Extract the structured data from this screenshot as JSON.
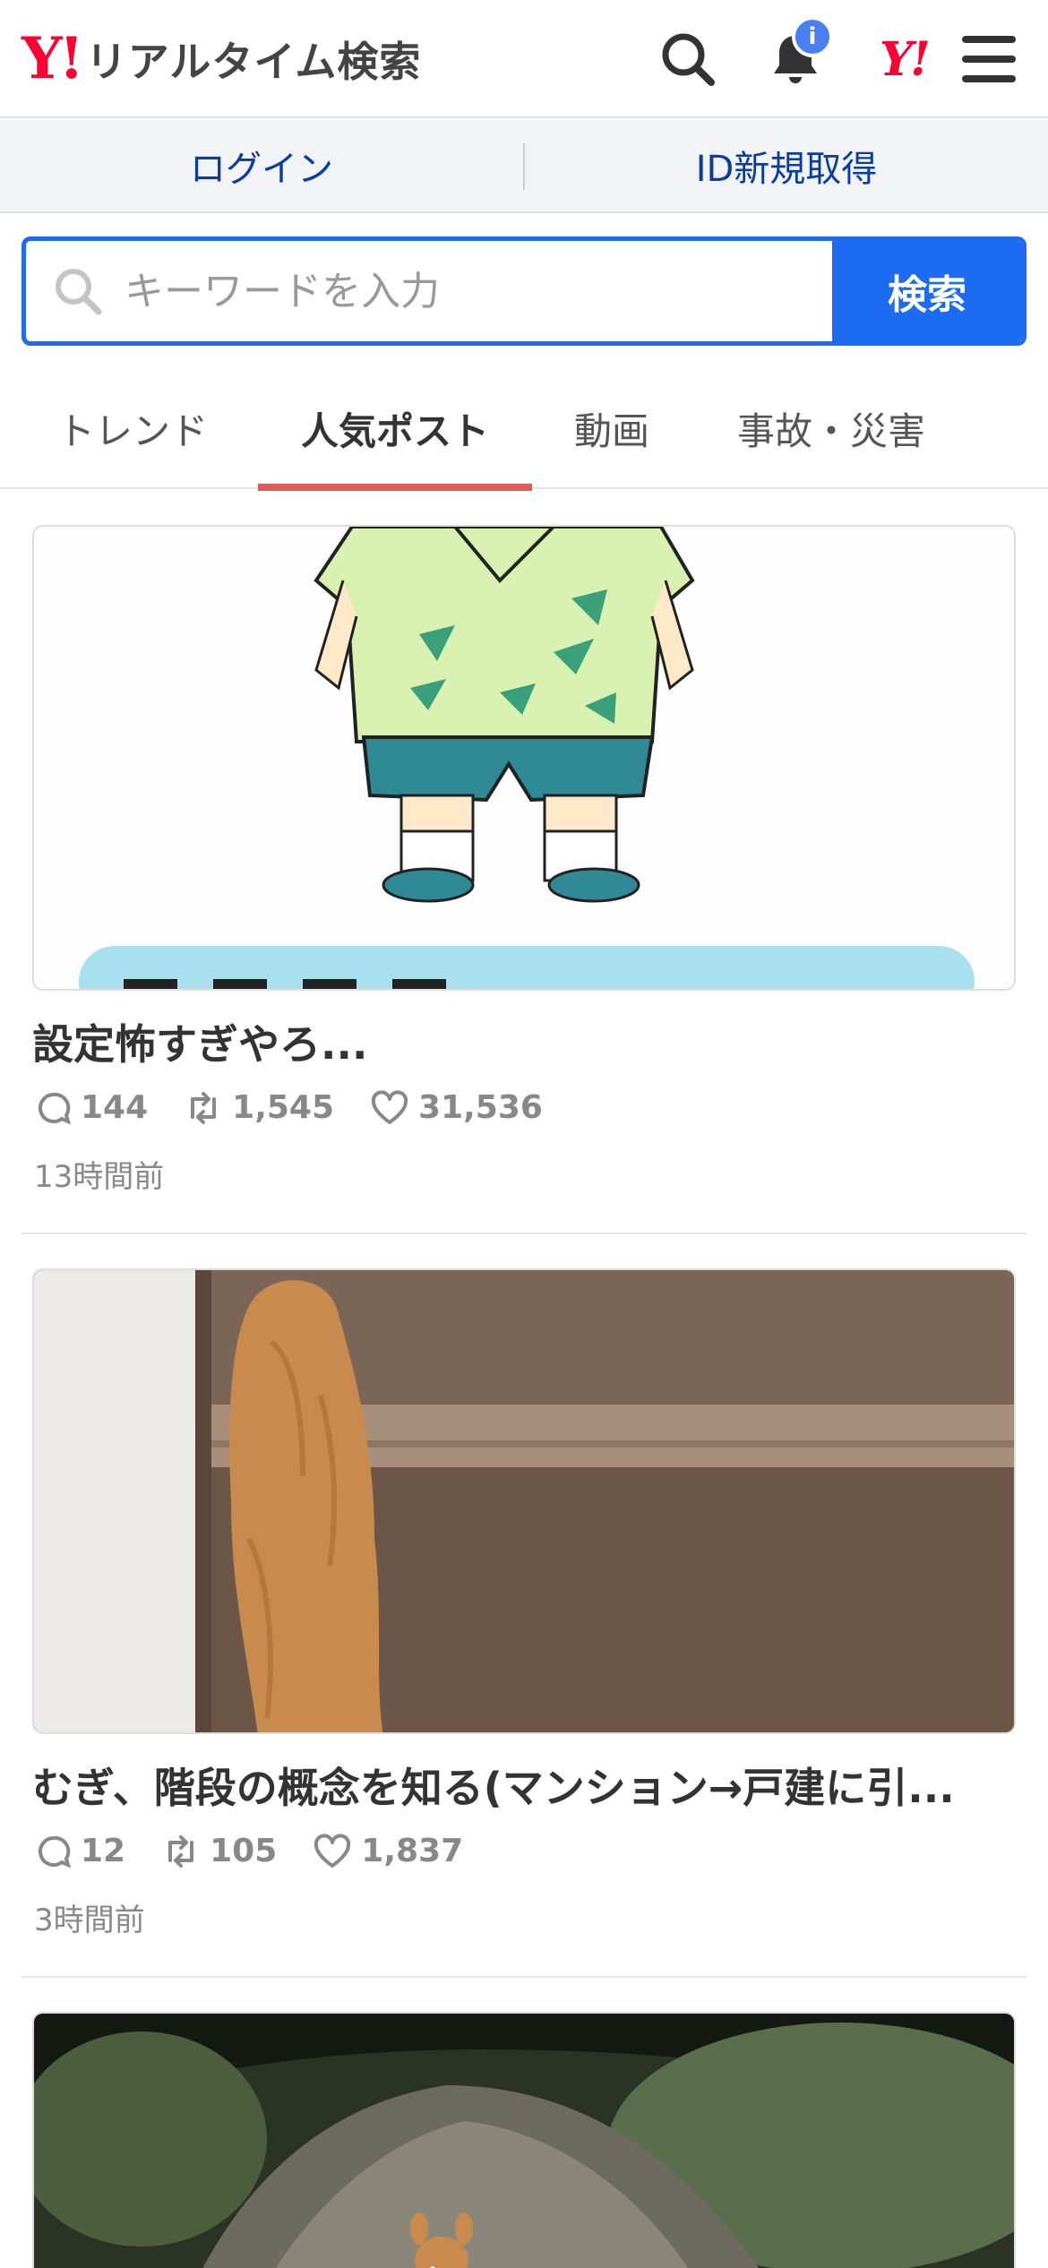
{
  "header": {
    "logo_mark": "Y!",
    "logo_text": "リアルタイム検索",
    "notification_badge": "i",
    "yahoo_mark": "Y!"
  },
  "account": {
    "login_label": "ログイン",
    "register_label": "ID新規取得"
  },
  "search": {
    "placeholder": "キーワードを入力",
    "button_label": "検索"
  },
  "tabs": [
    {
      "label": "トレンド",
      "active": false
    },
    {
      "label": "人気ポスト",
      "active": true
    },
    {
      "label": "動画",
      "active": false
    },
    {
      "label": "事故・災害",
      "active": false
    }
  ],
  "posts": [
    {
      "title": "設定怖すぎやろ...",
      "replies": "144",
      "reposts": "1,545",
      "likes": "31,536",
      "time": "13時間前"
    },
    {
      "title": "むぎ、階段の概念を知る(マンション→戸建に引...",
      "replies": "12",
      "reposts": "105",
      "likes": "1,837",
      "time": "3時間前"
    }
  ],
  "colors": {
    "brand_red": "#ff0033",
    "search_blue": "#1c6bf0",
    "tab_underline": "#e05a5a",
    "link_blue": "#0b3c9e"
  }
}
